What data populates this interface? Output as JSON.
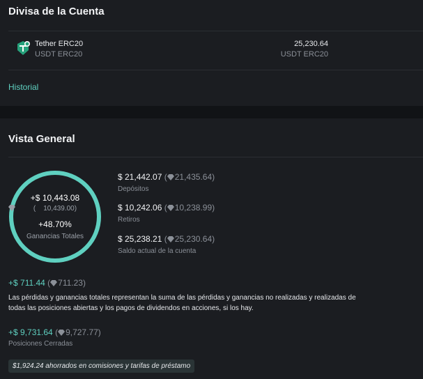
{
  "account_currency": {
    "title": "Divisa de la Cuenta",
    "coin": {
      "icon": "tether-icon",
      "name": "Tether ERC20",
      "code": "USDT ERC20",
      "amount": "25,230.64",
      "amount_code": "USDT ERC20"
    },
    "history_link": "Historial"
  },
  "overview": {
    "title": "Vista General",
    "ring": {
      "pnl": "+$ 10,443.08",
      "pnl_gem": "10,439.00",
      "percent": "+48.70%",
      "label": "Ganancias Totales",
      "fill_fraction": 1.0,
      "color": "#5fd0c0"
    },
    "stats": [
      {
        "value": "$ 21,442.07",
        "alt": "21,435.64",
        "label": "Depósitos"
      },
      {
        "value": "$ 10,242.06",
        "alt": "10,238.99",
        "label": "Retiros"
      },
      {
        "value": "$ 25,238.21",
        "alt": "25,230.64",
        "label": "Saldo actual de la cuenta"
      }
    ],
    "unrealized": {
      "value": "+$ 711.44",
      "alt": "711.23"
    },
    "description": "Las pérdidas y ganancias totales representan la suma de las pérdidas y ganancias no realizadas y realizadas de todas las posiciones abiertas y los pagos de dividendos en acciones, si los hay.",
    "closed": {
      "value": "+$ 9,731.64",
      "alt": "9,727.77",
      "label": "Posiciones Cerradas"
    },
    "saved_note": "$1,924.24 ahorrados en comisiones y tarifas de préstamo"
  },
  "colors": {
    "accent": "#5fd0c0",
    "panel": "#1b1d21",
    "background": "#0f1114"
  }
}
